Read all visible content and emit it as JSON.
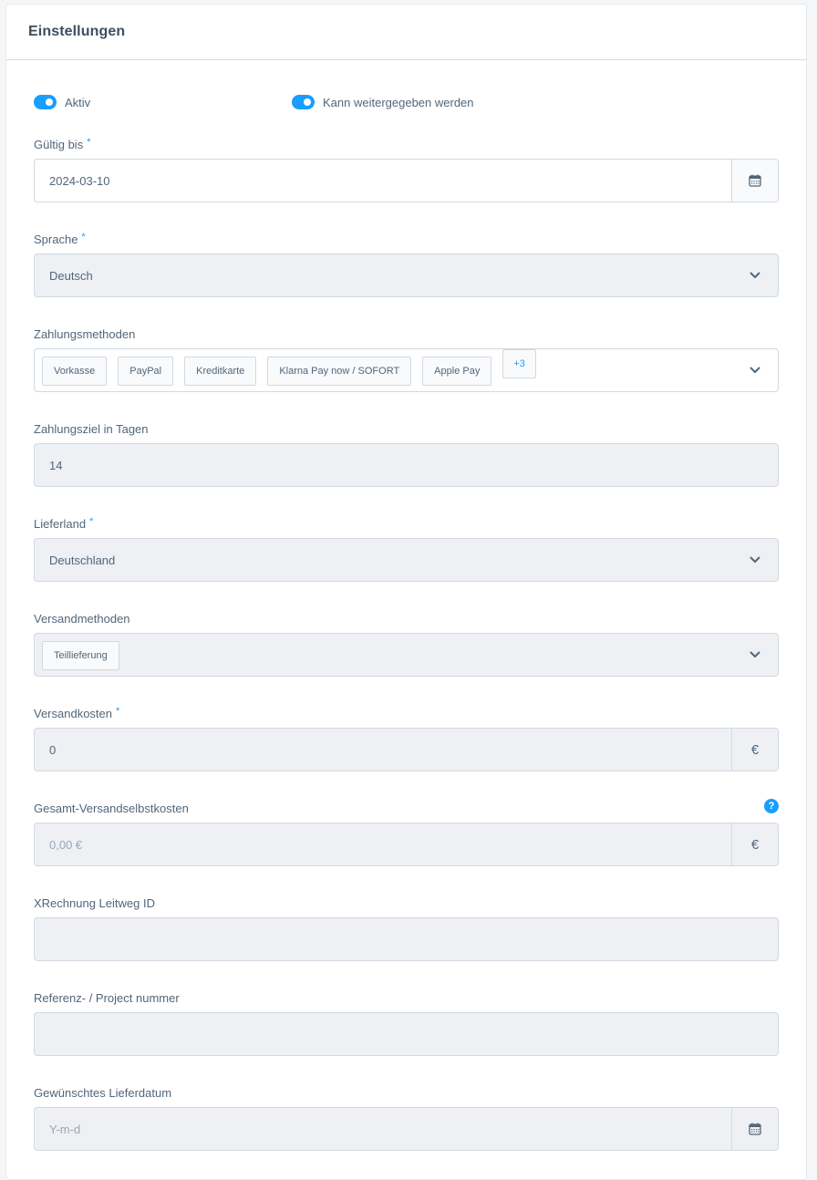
{
  "card": {
    "title": "Einstellungen"
  },
  "toggles": [
    {
      "label": "Aktiv",
      "checked": true
    },
    {
      "label": "Kann weitergegeben werden",
      "checked": true
    }
  ],
  "colors": {
    "accent": "#189eff",
    "text": "#52667a",
    "input_bg": "#eef0f4",
    "border": "#d1d9e0"
  },
  "fields": {
    "valid_until": {
      "label": "Gültig bis",
      "required": "*",
      "value": "2024-03-10",
      "icon": "calendar-icon"
    },
    "language": {
      "label": "Sprache",
      "required": "*",
      "value": "Deutsch",
      "icon": "chevron-down-icon"
    },
    "payment_methods": {
      "label": "Zahlungsmethoden",
      "tags": [
        "Vorkasse",
        "PayPal",
        "Kreditkarte",
        "Klarna Pay now / SOFORT",
        "Apple Pay"
      ],
      "more": "+3",
      "icon": "chevron-down-icon"
    },
    "payment_term": {
      "label": "Zahlungsziel in Tagen",
      "value": "14"
    },
    "delivery_country": {
      "label": "Lieferland",
      "required": "*",
      "value": "Deutschland",
      "icon": "chevron-down-icon"
    },
    "shipping_methods": {
      "label": "Versandmethoden",
      "tags": [
        "Teillieferung"
      ],
      "icon": "chevron-down-icon"
    },
    "shipping_costs": {
      "label": "Versandkosten",
      "required": "*",
      "value": "0",
      "suffix": "€"
    },
    "total_shipping_cost": {
      "label": "Gesamt-Versandselbstkosten",
      "value": "0,00 €",
      "suffix": "€",
      "help": "?"
    },
    "xrechnung": {
      "label": "XRechnung Leitweg ID",
      "value": ""
    },
    "reference": {
      "label": "Referenz- / Project nummer",
      "value": ""
    },
    "desired_delivery_date": {
      "label": "Gewünschtes Lieferdatum",
      "placeholder": "Y-m-d",
      "icon": "calendar-icon"
    }
  }
}
